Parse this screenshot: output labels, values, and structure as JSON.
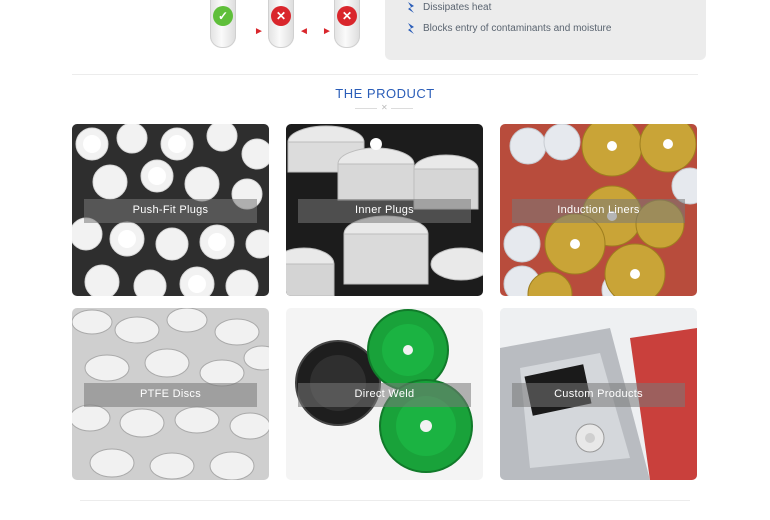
{
  "features": [
    {
      "text": "Dissipates heat",
      "icon": "blue-mark-icon"
    },
    {
      "text": "Blocks entry of contaminants and moisture",
      "icon": "blue-mark-icon"
    }
  ],
  "illustration": {
    "badges": [
      {
        "symbol": "✓",
        "status": "ok",
        "color": "#5fbf3a"
      },
      {
        "symbol": "✕",
        "status": "bad",
        "color": "#d9262c"
      },
      {
        "symbol": "✕",
        "status": "bad",
        "color": "#d9262c"
      }
    ]
  },
  "section": {
    "title": "THE PRODUCT",
    "deco": "✕"
  },
  "products": [
    {
      "label": "Push-Fit Plugs"
    },
    {
      "label": "Inner Plugs"
    },
    {
      "label": "Induction Liners"
    },
    {
      "label": "PTFE Discs"
    },
    {
      "label": "Direct Weld"
    },
    {
      "label": "Custom Products"
    }
  ],
  "colors": {
    "accent": "#2a5db8",
    "bad": "#d9262c",
    "ok": "#5fbf3a",
    "panel": "#ececec"
  }
}
